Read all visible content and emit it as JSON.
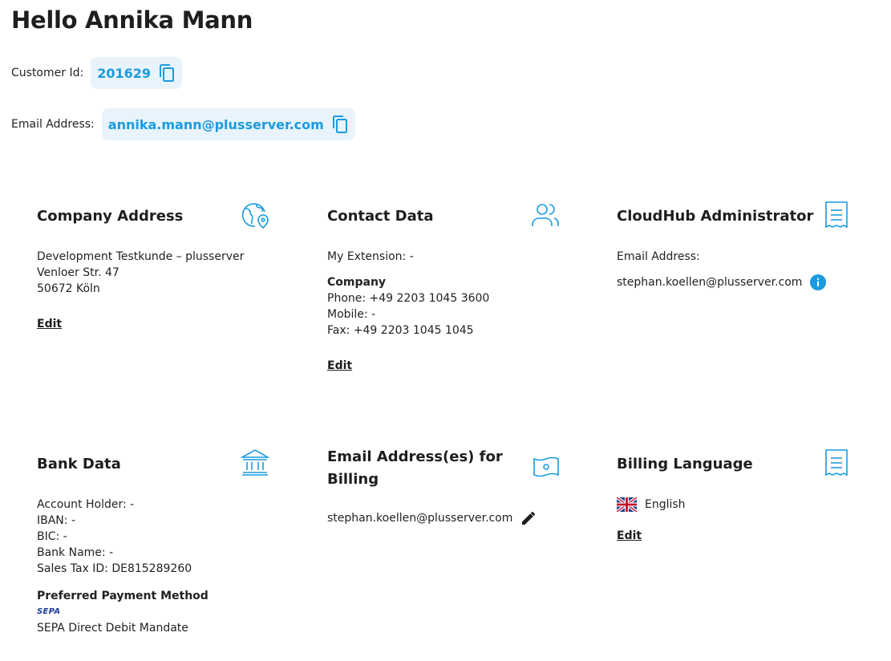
{
  "greeting": "Hello Annika Mann",
  "customer": {
    "id_label": "Customer Id:",
    "id_value": "201629",
    "email_label": "Email Address:",
    "email_value": "annika.mann@plusserver.com"
  },
  "company_address": {
    "title": "Company Address",
    "icon": "globe-location-icon",
    "lines": [
      "Development Testkunde – plusserver",
      "Venloer Str. 47",
      "50672 Köln"
    ],
    "edit": "Edit"
  },
  "contact_data": {
    "title": "Contact Data",
    "icon": "users-icon",
    "extension": "My Extension:  -",
    "company_heading": "Company",
    "phone": "Phone:  +49 2203 1045 3600",
    "mobile": "Mobile:  -",
    "fax": "Fax:  +49 2203 1045 1045",
    "edit": "Edit"
  },
  "cloudhub_admin": {
    "title": "CloudHub Administrator",
    "icon": "receipt-icon",
    "email_label": "Email Address:",
    "email": "stephan.koellen@plusserver.com",
    "info_icon": "info-icon"
  },
  "bank_data": {
    "title": "Bank Data",
    "icon": "bank-icon",
    "account_holder": "Account Holder:  -",
    "iban": "IBAN:  -",
    "bic": "BIC:  -",
    "bank_name": "Bank Name:  -",
    "sales_tax": "Sales Tax ID:  DE815289260",
    "payment_heading": "Preferred Payment Method",
    "sepa_logo": "SEPA",
    "payment_method": "SEPA Direct Debit Mandate"
  },
  "billing_email": {
    "title": "Email Address(es) for Billing",
    "icon": "money-icon",
    "email": "stephan.koellen@plusserver.com",
    "edit_icon": "pencil-icon"
  },
  "billing_language": {
    "title": "Billing Language",
    "icon": "receipt-icon",
    "flag": "uk-flag-icon",
    "language": "English",
    "edit": "Edit"
  },
  "colors": {
    "accent": "#1a9be0",
    "chip_bg": "#e8f3fb",
    "text": "#1e1e1e"
  }
}
